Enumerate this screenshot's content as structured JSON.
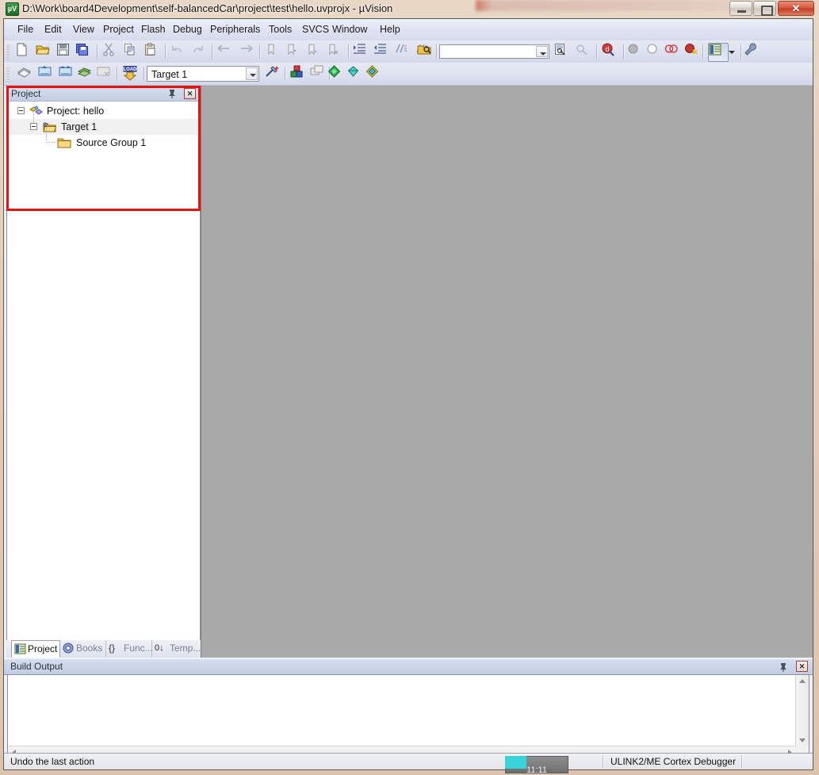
{
  "window": {
    "title": "D:\\Work\\board4Development\\self-balancedCar\\project\\test\\hello.uvprojx - µVision",
    "app_icon": "uvision-icon",
    "controls": {
      "minimize": "Minimize",
      "maximize": "Maximize",
      "close": "Close"
    }
  },
  "menubar": {
    "items": [
      {
        "label": "File"
      },
      {
        "label": "Edit"
      },
      {
        "label": "View"
      },
      {
        "label": "Project"
      },
      {
        "label": "Flash"
      },
      {
        "label": "Debug"
      },
      {
        "label": "Peripherals"
      },
      {
        "label": "Tools"
      },
      {
        "label": "SVCS"
      },
      {
        "label": "Window"
      },
      {
        "label": "Help"
      }
    ]
  },
  "toolbar_file": {
    "buttons": [
      {
        "name": "new-file-icon",
        "tip": "New"
      },
      {
        "name": "open-file-icon",
        "tip": "Open"
      },
      {
        "name": "save-icon",
        "tip": "Save"
      },
      {
        "name": "save-all-icon",
        "tip": "Save All"
      },
      {
        "name": "cut-icon",
        "tip": "Cut"
      },
      {
        "name": "copy-icon",
        "tip": "Copy"
      },
      {
        "name": "paste-icon",
        "tip": "Paste"
      },
      {
        "name": "undo-icon",
        "tip": "Undo"
      },
      {
        "name": "redo-icon",
        "tip": "Redo"
      },
      {
        "name": "navigate-back-icon",
        "tip": "Back"
      },
      {
        "name": "navigate-forward-icon",
        "tip": "Forward"
      },
      {
        "name": "bookmark-toggle-icon",
        "tip": "Insert/Remove Bookmark"
      },
      {
        "name": "bookmark-prev-icon",
        "tip": "Previous Bookmark"
      },
      {
        "name": "bookmark-next-icon",
        "tip": "Next Bookmark"
      },
      {
        "name": "bookmark-clear-icon",
        "tip": "Clear All Bookmarks"
      },
      {
        "name": "indent-icon",
        "tip": "Indent Selected Text"
      },
      {
        "name": "outdent-icon",
        "tip": "Unindent Selected Text"
      },
      {
        "name": "comment-icon",
        "tip": "Comment Selection"
      },
      {
        "name": "uncomment-icon",
        "tip": "Uncomment Selection"
      },
      {
        "name": "find-in-files-icon",
        "tip": "Find in Files"
      },
      {
        "name": "find-next-icon",
        "tip": "Find Next"
      },
      {
        "name": "incremental-find-icon",
        "tip": "Incremental Find"
      },
      {
        "name": "start-debug-icon",
        "tip": "Start/Stop Debug Session"
      },
      {
        "name": "insert-breakpoint-icon",
        "tip": "Insert/Remove Breakpoint"
      },
      {
        "name": "disable-breakpoint-icon",
        "tip": "Enable/Disable Breakpoint"
      },
      {
        "name": "disable-all-breakpoints-icon",
        "tip": "Disable All Breakpoints"
      },
      {
        "name": "kill-all-breakpoints-icon",
        "tip": "Kill All Breakpoints"
      },
      {
        "name": "window-manager-icon",
        "tip": "Manage Windows"
      },
      {
        "name": "configuration-wrench-icon",
        "tip": "Configuration"
      }
    ],
    "search": {
      "value": "",
      "placeholder": ""
    }
  },
  "toolbar_build": {
    "buttons": [
      {
        "name": "translate-icon",
        "tip": "Translate Current File"
      },
      {
        "name": "build-icon",
        "tip": "Build"
      },
      {
        "name": "rebuild-icon",
        "tip": "Rebuild"
      },
      {
        "name": "batch-build-icon",
        "tip": "Batch Build"
      },
      {
        "name": "stop-build-icon",
        "tip": "Stop Build"
      },
      {
        "name": "download-icon",
        "tip": "Download",
        "badge": "LOAD"
      },
      {
        "name": "target-options-icon",
        "tip": "Options for Target"
      },
      {
        "name": "manage-project-items-icon",
        "tip": "Manage Project Items"
      },
      {
        "name": "multi-project-icon",
        "tip": "Manage Multi-Project"
      },
      {
        "name": "pack-installer-icon",
        "tip": "Pack Installer"
      },
      {
        "name": "select-software-packs-icon",
        "tip": "Select Software Packs"
      },
      {
        "name": "manage-run-time-env-icon",
        "tip": "Manage Run-Time Environment"
      }
    ],
    "target_select": {
      "value": "Target 1",
      "name": "target-select"
    }
  },
  "project_panel": {
    "caption": "Project",
    "pin_tip": "Auto Hide",
    "close_tip": "Close",
    "tree": [
      {
        "label": "Project: hello",
        "icon": "project-icon",
        "level": 0,
        "expanded": true,
        "selected": false
      },
      {
        "label": "Target 1",
        "icon": "target-folder-icon",
        "level": 1,
        "expanded": true,
        "selected": true
      },
      {
        "label": "Source Group 1",
        "icon": "folder-icon",
        "level": 2,
        "expanded": false,
        "selected": false
      }
    ],
    "tabs": [
      {
        "label": "Project",
        "icon": "project-tab-icon",
        "active": true
      },
      {
        "label": "Books",
        "icon": "books-tab-icon",
        "active": false
      },
      {
        "label": "Func...",
        "icon": "functions-tab-icon",
        "active": false
      },
      {
        "label": "Temp...",
        "icon": "templates-tab-icon",
        "active": false
      }
    ]
  },
  "build_output": {
    "caption": "Build Output",
    "content": "",
    "pin_tip": "Auto Hide",
    "close_tip": "Close"
  },
  "statusbar": {
    "message": "Undo the last action",
    "debugger": "ULINK2/ME Cortex Debugger"
  },
  "taskbar_peek": {
    "clock": "11:11"
  },
  "colors": {
    "highlight_box": "#e51414",
    "mdi_background": "#a9a9a9",
    "caption_gradient_top": "#d6deee",
    "caption_gradient_bottom": "#c3cee4",
    "frame": "#e3cdb9",
    "close_button": "#d5573c"
  }
}
